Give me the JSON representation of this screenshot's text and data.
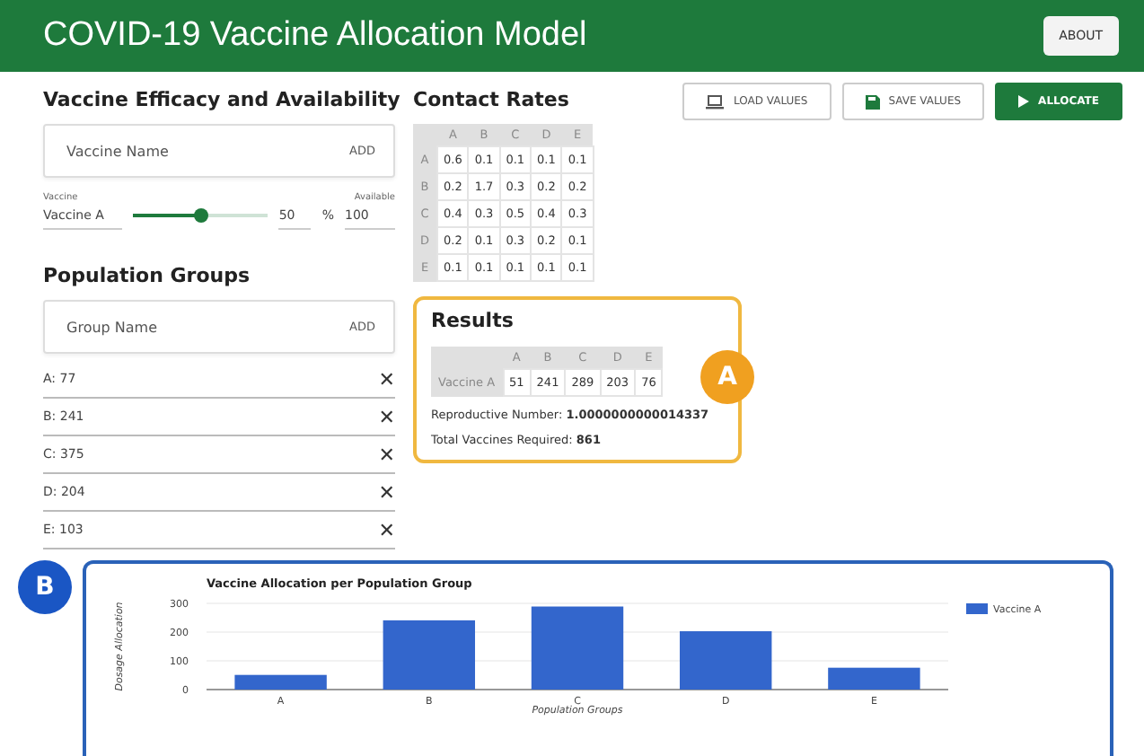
{
  "header": {
    "title": "COVID-19 Vaccine Allocation Model",
    "about_button": "ABOUT"
  },
  "vaccine_section": {
    "title": "Vaccine Efficacy and Availability",
    "name_field": {
      "placeholder": "Vaccine Name"
    },
    "add_button": "ADD",
    "vaccines": [
      {
        "name_label": "Vaccine",
        "name": "Vaccine A",
        "level": 0.5,
        "efficacy": "50",
        "unit": "%",
        "available_label": "Available",
        "available": "100"
      }
    ]
  },
  "population_section": {
    "title": "Population Groups",
    "name_field": {
      "placeholder": "Group Name"
    },
    "add_button": "ADD",
    "remove_icon": "✕",
    "groups": [
      "A: 77",
      "B: 241",
      "C: 375",
      "D: 204",
      "E: 103"
    ]
  },
  "contact_rates": {
    "title": "Contact Rates",
    "columns": [
      "A",
      "B",
      "C",
      "D",
      "E"
    ],
    "rows": [
      {
        "label": "A",
        "values": [
          "0.6",
          "0.1",
          "0.1",
          "0.1",
          "0.1"
        ]
      },
      {
        "label": "B",
        "values": [
          "0.2",
          "1.7",
          "0.3",
          "0.2",
          "0.2"
        ]
      },
      {
        "label": "C",
        "values": [
          "0.4",
          "0.3",
          "0.5",
          "0.4",
          "0.3"
        ]
      },
      {
        "label": "D",
        "values": [
          "0.2",
          "0.1",
          "0.3",
          "0.2",
          "0.1"
        ]
      },
      {
        "label": "E",
        "values": [
          "0.1",
          "0.1",
          "0.1",
          "0.1",
          "0.1"
        ]
      }
    ]
  },
  "actions": [
    {
      "kind": "load",
      "label": "LOAD VALUES"
    },
    {
      "kind": "save",
      "label": "SAVE VALUES"
    },
    {
      "kind": "allocate",
      "label": "ALLOCATE"
    }
  ],
  "results": {
    "title": "Results",
    "columns": [
      "A",
      "B",
      "C",
      "D",
      "E"
    ],
    "rows": [
      {
        "label": "Vaccine A",
        "values": [
          "51",
          "241",
          "289",
          "203",
          "76"
        ]
      }
    ],
    "reproductive_label": "Reproductive Number:",
    "reproductive_value": "1.0000000000014337",
    "total_label": "Total Vaccines Required:",
    "total_value": "861",
    "badge": "A"
  },
  "chart_panel": {
    "badge": "B",
    "chart_data": {
      "type": "bar",
      "title": "Vaccine Allocation per Population Group",
      "xlabel": "Population Groups",
      "ylabel": "Dosage Allocation",
      "categories": [
        "A",
        "B",
        "C",
        "D",
        "E"
      ],
      "series": [
        {
          "name": "Vaccine A",
          "color": "#3366cc",
          "values": [
            51,
            241,
            289,
            203,
            76
          ]
        }
      ],
      "ylim": [
        0,
        300
      ],
      "yticks": [
        0,
        100,
        200,
        300
      ]
    }
  }
}
